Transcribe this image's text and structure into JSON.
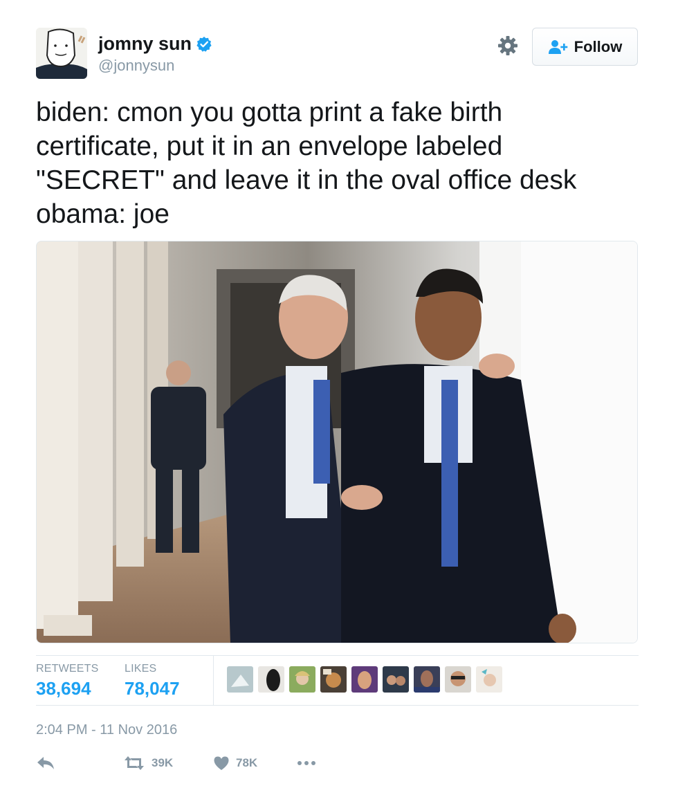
{
  "user": {
    "name": "jomny sun",
    "handle": "@jonnysun",
    "verified_icon": "verified-badge-icon"
  },
  "header": {
    "settings_icon": "gear-icon",
    "follow_label": "Follow"
  },
  "tweet": {
    "text": "biden: cmon you gotta print a fake birth\ncertificate, put it in an envelope labeled\n\"SECRET\" and leave it in the oval office desk\nobama: joe",
    "media_description": "photo"
  },
  "stats": {
    "retweets_label": "RETWEETS",
    "retweets_value": "38,694",
    "likes_label": "LIKES",
    "likes_value": "78,047",
    "liker_avatar_count": 9
  },
  "timestamp": "2:04 PM - 11 Nov 2016",
  "actions": {
    "reply_icon": "reply-icon",
    "retweet_icon": "retweet-icon",
    "retweet_count": "39K",
    "like_icon": "heart-icon",
    "like_count": "78K",
    "more_icon": "more-dots-icon"
  },
  "colors": {
    "accent": "#1da1f2",
    "muted": "#8899a6",
    "text": "#14171a",
    "border": "#e1e8ed"
  }
}
